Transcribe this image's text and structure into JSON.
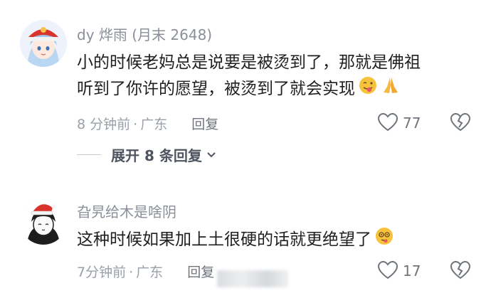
{
  "comments": [
    {
      "username": "dy 烨雨",
      "member_tag": "(月末 2648)",
      "text_lines": [
        "小的时候老妈总是说要是被烫到了，那就是佛祖",
        "听到了你许的愿望，被烫到了就会实现"
      ],
      "emojis": [
        "tongue-emoji",
        "pray-hands-emoji"
      ],
      "time": "8 分钟前",
      "location": "广东",
      "reply_label": "回复",
      "likes": "77",
      "avatar": "anime-girl-red-hat-avatar"
    },
    {
      "username": "旮旯给木是啥阴",
      "member_tag": "",
      "text_lines": [
        "这种时候如果加上土很硬的话就更绝望了"
      ],
      "emojis": [
        "dizzy-face-emoji"
      ],
      "time": "7分钟前",
      "location": "广东",
      "reply_label": "回复",
      "likes": "17",
      "avatar": "christmas-hat-character-avatar"
    }
  ],
  "expand_replies": "展开 8 条回复",
  "separator": "·",
  "colors": {
    "text": "#1f1f1f",
    "meta": "#9aa0a8",
    "name": "#8a8f99",
    "accent_red": "#d8342c"
  }
}
